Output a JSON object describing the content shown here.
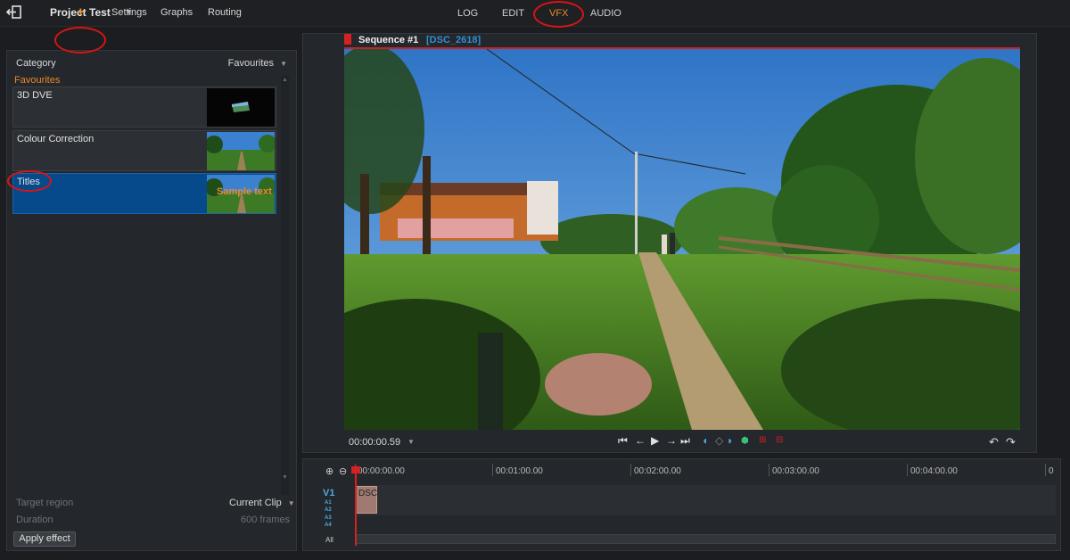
{
  "app": {
    "project_title": "Project Test",
    "modes": [
      "LOG",
      "EDIT",
      "VFX",
      "AUDIO"
    ],
    "active_mode": "VFX"
  },
  "left_tabs": {
    "add": "+",
    "settings": "Settings",
    "graphs": "Graphs",
    "routing": "Routing"
  },
  "effects_panel": {
    "category_label": "Category",
    "category_value": "Favourites",
    "group_label": "Favourites",
    "items": [
      {
        "label": "3D DVE",
        "selected": false
      },
      {
        "label": "Colour Correction",
        "selected": false
      },
      {
        "label": "Titles",
        "selected": true,
        "thumb_text": "Sample text"
      }
    ],
    "target_region_label": "Target region",
    "target_region_value": "Current Clip",
    "duration_label": "Duration",
    "duration_value": "600 frames",
    "apply_label": "Apply effect"
  },
  "viewer": {
    "sequence_title": "Sequence #1",
    "clip_name": "[DSC_2618]",
    "timecode": "00:00:00.59"
  },
  "timeline": {
    "ruler_labels": [
      "00:00:00.00",
      "00:01:00.00",
      "00:02:00.00",
      "00:03:00.00",
      "00:04:00.00",
      "0"
    ],
    "video_track": "V1",
    "audio_tracks": [
      "A1",
      "A2",
      "A3",
      "A4"
    ],
    "clip_label": "DSC",
    "all_label": "All"
  },
  "colors": {
    "accent_orange": "#e8892b",
    "selection_blue": "#074a8b",
    "track_blue": "#4fa9e6",
    "playhead_red": "#d42121",
    "annotation_red": "#d81515"
  }
}
